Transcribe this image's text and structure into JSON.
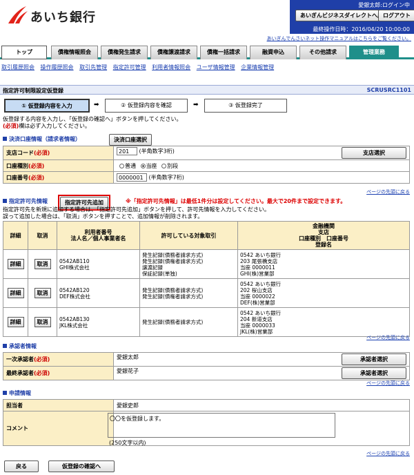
{
  "header": {
    "bank_name": "あいち銀行",
    "user_login": "愛銀太郎:ログイン中",
    "btn_back_direct": "あいぎんビジネスダイレクトへ戻る",
    "btn_logout": "ログアウト",
    "last_op": "最終操作日時：2016/04/20 10:00:00",
    "manual_link": "あいぎんでんさいネット操作マニュアルはこちらをご覧ください。"
  },
  "tabs": [
    "トップ",
    "債権情報照会",
    "債権発生請求",
    "債権譲渡請求",
    "債権一括請求",
    "融資申込",
    "その他請求",
    "管理業務"
  ],
  "subnav": [
    "取引履歴照会",
    "操作履歴照会",
    "取引先管理",
    "指定許可管理",
    "利用者情報照会",
    "ユーザ情報管理",
    "企業情報管理"
  ],
  "title": {
    "text": "指定許可制限設定仮登録",
    "code": "SCRUSRC1101"
  },
  "steps": [
    "① 仮登録内容を入力",
    "② 仮登録内容を確認",
    "③ 仮登録完了"
  ],
  "intro": {
    "line1": "仮登録する内容を入力し、「仮登録の確認へ」ボタンを押してください。",
    "req_mark": "(必須)",
    "line2": "欄は必ず入力してください。"
  },
  "settlement": {
    "heading": "決済口座情報（請求者情報）",
    "select_btn": "決済口座選択",
    "branch_label": "支店コード",
    "branch_value": "201",
    "branch_hint": "(半角数字3桁)",
    "branch_btn": "支店選択",
    "type_label": "口座種別",
    "types": [
      "普通",
      "当座",
      "別段"
    ],
    "acct_label": "口座番号",
    "acct_value": "0000001",
    "acct_hint": "(半角数字7桁)",
    "req": "(必須)"
  },
  "to_top": "ページの先頭に戻る",
  "permit": {
    "heading": "指定許可先情報",
    "add_btn": "指定許可先追加",
    "warn": "※「指定許可先情報」は最低1件分は設定してください。最大で20件まで設定できます。",
    "note1": "指定許可先を新規に追加する場合は、「指定許可先追加」ボタンを押して、許可先情報を入力してください。",
    "note2": "誤って追加した場合は、「取消」ボタンを押すことで、追加情報が削除されます。",
    "col_detail": "詳細",
    "col_cancel": "取消",
    "col_user": "利用者番号\n法人名／個人事業者名",
    "col_target": "許可している対象取引",
    "col_bank": "金融機関\n支店\n口座種別　口座番号\n登録名",
    "btn_detail": "詳細",
    "btn_cancel": "取消",
    "rows": [
      {
        "user": "0542AB110\nGHI株式会社",
        "target": "発生記録(債務者請求方式)\n発生記録(債権者請求方式)\n譲渡記録\n保証記録(単独)",
        "bank": "0542 あいち銀行\n203 尾張橋支店\n当座 0000011\nGHI(株)営業部"
      },
      {
        "user": "0542AB120\nDEF株式会社",
        "target": "発生記録(債務者請求方式)\n発生記録(債権者請求方式)",
        "bank": "0542 あいち銀行\n202 桜山支店\n当座 0000022\nDEF(株)営業部"
      },
      {
        "user": "0542AB130\nJKL株式会社",
        "target": "発生記録(債務者請求方式)",
        "bank": "0542 あいち銀行\n204 新道支店\n当座 0000033\nJKL(株)営業部"
      }
    ]
  },
  "approver": {
    "heading": "承認者情報",
    "first_label": "一次承認者",
    "first_value": "愛銀太郎",
    "final_label": "最終承認者",
    "final_value": "愛銀花子",
    "btn": "承認者選択",
    "req": "(必須)"
  },
  "apply": {
    "heading": "申請情報",
    "person_label": "担当者",
    "person_value": "愛銀史郎",
    "comment_label": "コメント",
    "comment_value": "〇〇を仮登録します。",
    "comment_hint": "(250文字以内)"
  },
  "footer": {
    "back": "戻る",
    "confirm": "仮登録の確認へ"
  }
}
